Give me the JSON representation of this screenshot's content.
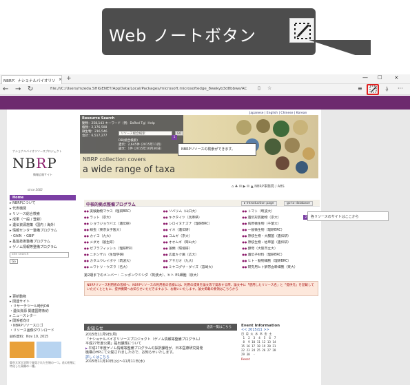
{
  "callout": {
    "label": "Web ノートボタン",
    "icon": "pen-on-slash-icon"
  },
  "browser": {
    "tab_title": "NBRP：ナショナルバイオリソ",
    "tab_close": "×",
    "new_tab": "+",
    "window_min": "—",
    "window_max": "□",
    "window_close": "×",
    "back": "←",
    "forward": "→",
    "refresh": "↻",
    "url": "file:///C:/Users/mzeda.SHIGENET/AppData/Local/Packages/microsoft.microsoftedge_8wekyb3d8bbwe/AC",
    "reading_view": "▯",
    "favorite": "☆",
    "hub": "≡",
    "share": "⍙",
    "more": "···"
  },
  "page": {
    "languages": "Japanese | English | Chinese | Korean",
    "logo_sub": "ナショナルバイオリソースプロジェクト",
    "logo_prefix": "NB",
    "logo_r": "R",
    "logo_suffix": "P",
    "logo_jp": "情報広報サイト",
    "logo_since": "since 2002",
    "resource_search": {
      "title": "Resource Search",
      "line1": "動物：258,143 キーワード（例：DsRed Tg）Help",
      "line2": "植物：2,176,508",
      "line3": "微生物：216,546",
      "line4": "合計：6,517,277",
      "placeholder": "リソース総合検索",
      "go": "GO",
      "line5": "DB(統合検索)",
      "line6": "遺伝：2,645件 (2015年11月)",
      "line7": "論文：1件 (2015年10月30日)"
    },
    "hero_title1": "NBRP collection covers",
    "hero_title2": "a wide range of taxa",
    "tip1": "NBRPリソースの検索ができます。",
    "tip1_badge": "1",
    "tip2": "各リソースのサイトはここから",
    "tip2_badge": "2",
    "icons_row": "⌂ ♣ ✉ ▶ ✉ ▲ NBRP事務局 / ABS",
    "sidebar": [
      "Home",
      "▸ NBRPについて",
      "▸ 代表機関",
      "▸ リソース総合検索",
      "▸ 成果（一般 / 登録）",
      "▸ 遺伝資源施策（国内 / 海外）",
      "▸ 情報センター整備プログラム",
      "  ・GAIN ・GBIF",
      "▸ 基盤技術整備プログラム",
      "▸ ゲノム情報等整備プログラム"
    ],
    "sidebar_search": "site search",
    "sidebar_go": "Go",
    "center_title": "中核的拠点整備プログラム",
    "intro_btn": "▸ Introduction page",
    "db_btn": "go to database",
    "resources": [
      "実験動物マウス（理研BRC）",
      "ソバリム（山口大）",
      "トマト（筑波大）",
      "ラット（京大）",
      "キクタイツ（兵庫県）",
      "遺伝形質動物（京大）",
      "ショウジョウバエ（遺伝研）",
      "シロイヌナズナ（理研BRC）",
      "病原微生物（千葉大）",
      "線虫（東京女子医大）",
      "イネ（遺伝研）",
      "一般微生物（理研BRC）",
      "カイコ（九大）",
      "コムギ（京大）",
      "原核生物・大腸菌（遺伝研）",
      "メダカ（基生研）",
      "オオムギ（岡山大）",
      "原核生物・枯草菌（遺伝研）",
      "ゼブラフィッシュ（理研BSI）",
      "藻類（環境研）",
      "酵母（大阪市立大）",
      "ニホンザル（生理学研）",
      "広義キク属（広大）",
      "遺伝子材料（理研BRC）",
      "カタユウレイボヤ（筑波大）",
      "アサガオ（九大）",
      "ヒト・動物細胞（理研BRC）",
      "ニワトリ・ウズラ（名大）",
      "ミヤコグサ・ダイズ（宮崎大）",
      "研究用ヒト臍帯血幹細胞（東大）"
    ],
    "second_gen": "第2期までのメンバー：ニッポンウミシダ（筑波大）、ヒト ES細胞（京大）",
    "notice": "NBRPリソース利用者の皆様へ：NBRPリソースの利用者の皆様には、利用の成果を論文等で発表する際、論文中に「使用したリソース名」と「提供元」を記載していただくとともに、提供機関へお知らせいただきますよう、お願いいたします。論文掲載の要領はこちらから",
    "news_title": "お知らせ",
    "news_more": "過去一覧はこちら",
    "news": [
      "2015年11月9日(月)",
      "「ナショナルバイオリソースプロジェクト（ゲノム情報等整備プログラム）",
      "平成27年度公募」提出課題について",
      "平成27年度ゲノム情報等整備プログラムの採択課題が、日本医療研究開発",
      "機構のHPにて公開されましたので、お知らせいたします。",
      "詳しくはこちら",
      "2015年11月10日(火)〜11月11日(水)"
    ],
    "event": {
      "title": "Event Information",
      "month": "<<   2015/11   >>",
      "days": "日 月 火 水 木 金 土\n 1  2  3  4  5  6  7\n 8  9 10 11 12 13 14\n15 16 17 18 19 20 21\n22 23 24 25 26 27 28\n29 30  -",
      "reset": "Reset"
    },
    "left_lower": [
      "▸ 更新動物",
      "▸ 関連サイト",
      "  ・リサーチツール時代DB",
      "  ・遺伝資源 関連国際条約",
      "▸ ニュースレター",
      "▸ 関係者向け",
      "  ・NBRPリソースロゴ",
      "  ・リソース画像ダウンロード"
    ],
    "bird_title": "創作資料：Nov 10, 2015",
    "bird_foot": "東京大学大学院で発見された生物の一つ。花の形態に特化した鳥類の一種。"
  }
}
